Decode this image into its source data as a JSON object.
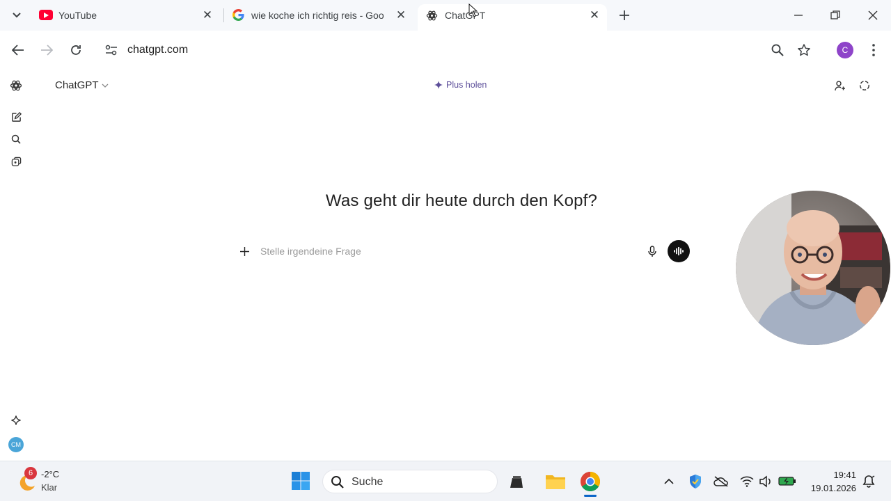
{
  "browser": {
    "tabs": [
      {
        "label": "YouTube",
        "icon": "youtube-icon"
      },
      {
        "label": "wie koche ich richtig reis - Goo",
        "icon": "google-icon"
      },
      {
        "label": "ChatGPT",
        "icon": "chatgpt-icon",
        "active": true
      }
    ],
    "url": "chatgpt.com",
    "profile_initial": "C"
  },
  "chatgpt": {
    "model_name": "ChatGPT",
    "plus_label": "Plus holen",
    "headline": "Was geht dir heute durch den Kopf?",
    "composer_placeholder": "Stelle irgendeine Frage",
    "user_initials": "CM"
  },
  "taskbar": {
    "weather_badge": "6",
    "temperature": "-2°C",
    "weather_desc": "Klar",
    "search_label": "Suche",
    "time": "19:41",
    "date": "19.01.2026"
  },
  "colors": {
    "tabstrip_bg": "#f6f8fb",
    "youtube_red": "#ff0033",
    "plus_purple": "#5d4f9a",
    "profile_purple": "#8e44c9",
    "cm_blue": "#4aa5d8"
  }
}
